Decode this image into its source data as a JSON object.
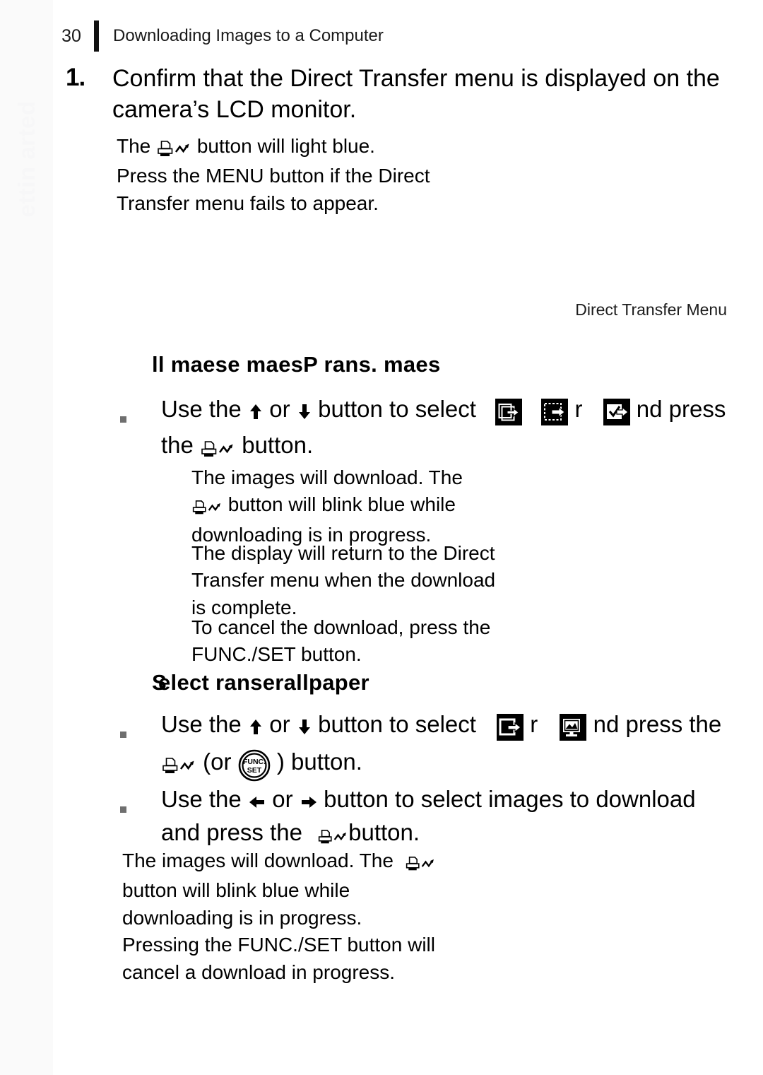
{
  "page": {
    "number": "30",
    "header_title": "Downloading Images to a Computer",
    "chapter_tab": "ettin  arted"
  },
  "step1": {
    "number": "1.",
    "title": "Confirm that the Direct Transfer menu is displayed on the camera’s LCD monitor.",
    "notes": {
      "line1_before": "The",
      "line1_after": "button will light blue.",
      "line2": "Press the MENU button if the Direct",
      "line3": "Transfer menu fails to appear."
    }
  },
  "figure": {
    "caption": "Direct Transfer Menu"
  },
  "section_all_images": {
    "heading": "ll maese maesP rans. maes",
    "bullet": {
      "part1": "Use the",
      "part2": "or",
      "part3": "button to select",
      "part4": "r",
      "part5": "nd press",
      "line2_before": "the",
      "line2_after": "button.",
      "arrow_up": "↑",
      "arrow_down": "↓"
    },
    "notes": {
      "p1_line1": "The images will download. The",
      "p1_line2_after": "button will blink blue while",
      "p1_line3": "downloading is in progress.",
      "p2_line1": "The display will return to the Direct",
      "p2_line2": "Transfer menu when the download",
      "p2_line3": "is complete.",
      "p3_line1": "To cancel the download, press the",
      "p3_line2": "FUNC./SET button."
    }
  },
  "section_select_transfer": {
    "heading_part1": "S",
    "heading_part2": "elect  ranserallpaper",
    "bullet1": {
      "part1": "Use the",
      "part2": "or",
      "part3": "button to select",
      "part4": "r",
      "part5": "nd press the",
      "line2_or": "(or",
      "line2_after": ") button."
    },
    "bullet2": {
      "part1": "Use the",
      "part2": "or",
      "part3": "button to select images to download",
      "line2_before": "and press the",
      "line2_after": "button.",
      "arrow_left": "←",
      "arrow_right": "→"
    },
    "notes": {
      "line1": "The images will download. The",
      "line2": "button will blink blue while",
      "line3": "downloading is in progress.",
      "line4": "Pressing the FUNC./SET button will",
      "line5": "cancel a download in progress."
    }
  },
  "icons": {
    "print_share": "print-share-icon",
    "all_images": "all-images-icon",
    "new_images": "new-images-icon",
    "dpof_transfer": "dpof-transfer-icon",
    "select_transfer": "select-transfer-icon",
    "wallpaper": "wallpaper-icon",
    "func_set": "func-set-icon",
    "func_label_top": "FUNC.",
    "func_label_bottom": "SET"
  },
  "colors": {
    "ink": "#000000",
    "band": "#fafafa",
    "tab_text": "#f7f7f8",
    "bullet": "#6f6f6f"
  }
}
